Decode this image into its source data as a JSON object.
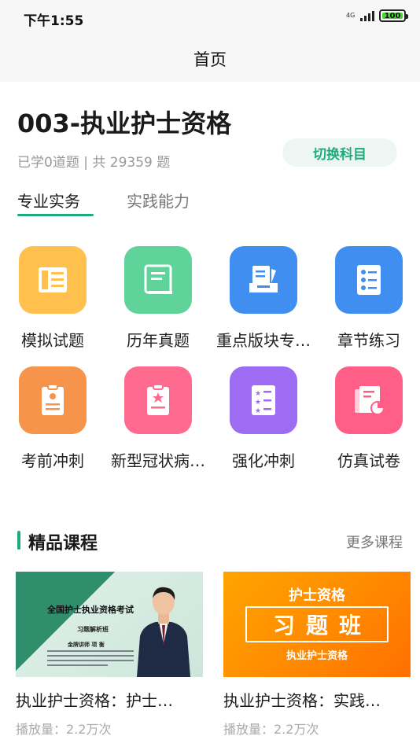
{
  "status": {
    "time": "下午1:55",
    "network": "4G",
    "battery": "100",
    "battery_level": 1.0
  },
  "header": {
    "title": "首页"
  },
  "subject": {
    "name": "003-执业护士资格",
    "stats": "已学0道题 | 共 29359 题",
    "switch_label": "切换科目"
  },
  "tabs": [
    {
      "label": "专业实务",
      "active": true
    },
    {
      "label": "实践能力",
      "active": false
    }
  ],
  "grid": [
    {
      "label": "模拟试题",
      "icon": "mock-exam-icon",
      "color": "#ffc04d"
    },
    {
      "label": "历年真题",
      "icon": "past-papers-icon",
      "color": "#5fd39a"
    },
    {
      "label": "重点版块专…",
      "icon": "key-topics-icon",
      "color": "#3f8ef0"
    },
    {
      "label": "章节练习",
      "icon": "chapter-practice-icon",
      "color": "#3f8ef0"
    },
    {
      "label": "考前冲刺",
      "icon": "pre-exam-sprint-icon",
      "color": "#f5944a"
    },
    {
      "label": "新型冠状病…",
      "icon": "covid-icon",
      "color": "#ff6b8f"
    },
    {
      "label": "强化冲刺",
      "icon": "intensive-sprint-icon",
      "color": "#9d6cf2"
    },
    {
      "label": "仿真试卷",
      "icon": "simulation-paper-icon",
      "color": "#ff5f86"
    }
  ],
  "section": {
    "title": "精品课程",
    "more": "更多课程",
    "accent": "#1faa7e"
  },
  "courses": [
    {
      "title": "执业护士资格：护士…",
      "plays": "播放量：2.2万次",
      "thumb": {
        "heading": "全国护士执业资格考试",
        "subheading": "习题解析班",
        "teacher": "金牌讲师 项 衡"
      }
    },
    {
      "title": "执业护士资格：实践…",
      "plays": "播放量：2.2万次",
      "thumb": {
        "top": "护士资格",
        "box": "习题班",
        "bottom": "执业护士资格"
      }
    }
  ]
}
